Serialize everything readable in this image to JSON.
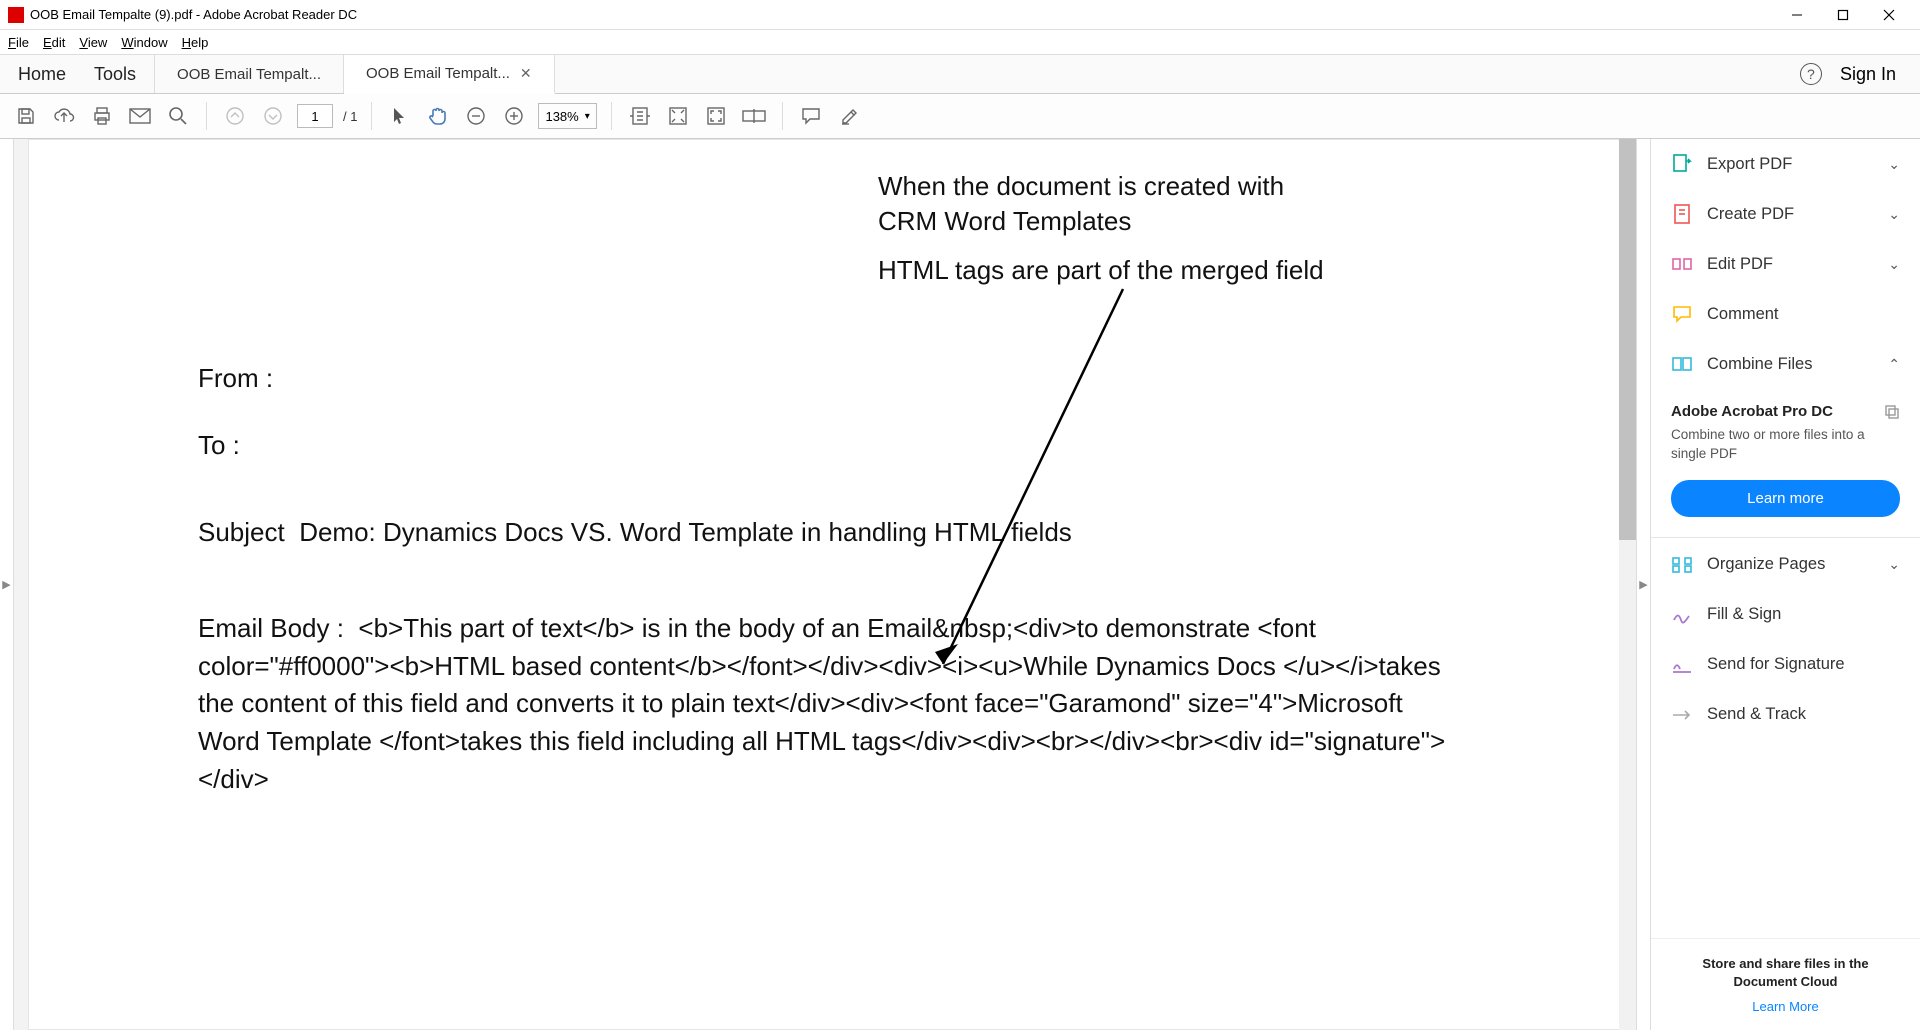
{
  "titlebar": {
    "text": "OOB Email Tempalte (9).pdf - Adobe Acrobat Reader DC"
  },
  "menubar": {
    "file": "File",
    "edit": "Edit",
    "view": "View",
    "window": "Window",
    "help": "Help"
  },
  "nav": {
    "home": "Home",
    "tools": "Tools",
    "tab1": "OOB Email Tempalt...",
    "tab2": "OOB Email Tempalt...",
    "signin": "Sign In"
  },
  "toolbar": {
    "page_current": "1",
    "page_total": "/ 1",
    "zoom": "138%"
  },
  "annotation": {
    "line1": "When the document is created with",
    "line2": "CRM Word Templates",
    "line3": "HTML tags are part of the merged field"
  },
  "doc": {
    "from": "From :",
    "to": "To :",
    "subject_label": "Subject",
    "subject_value": "Demo: Dynamics Docs VS. Word Template in handling HTML fields",
    "body_label": "Email Body :",
    "body_text": "<b>This part of text</b> is in the body of an Email&nbsp;<div>to demonstrate <font color=\"#ff0000\"><b>HTML based content</b></font></div><div><i><u>While Dynamics Docs </u></i>takes the content of this field and converts it to plain text</div><div><font face=\"Garamond\" size=\"4\">Microsoft Word Template </font>takes this field including all HTML tags</div><div><br></div><br><div id=\"signature\"></div>"
  },
  "rpanel": {
    "export": "Export PDF",
    "create": "Create PDF",
    "edit": "Edit PDF",
    "comment": "Comment",
    "combine": "Combine Files",
    "promo_title": "Adobe Acrobat Pro DC",
    "promo_desc": "Combine two or more files into a single PDF",
    "learn": "Learn more",
    "organize": "Organize Pages",
    "fill": "Fill & Sign",
    "signature": "Send for Signature",
    "send": "Send & Track",
    "foot_text": "Store and share files in the Document Cloud",
    "foot_link": "Learn More"
  }
}
